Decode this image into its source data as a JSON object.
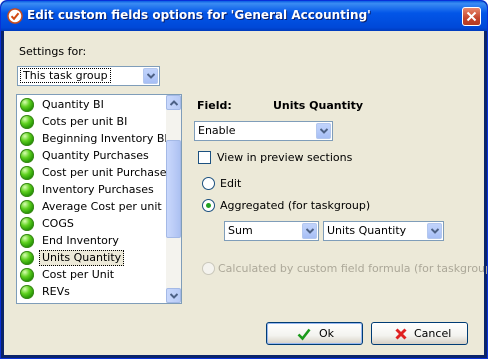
{
  "window": {
    "title": "Edit custom fields options for  'General Accounting'",
    "icons": {
      "app": "check-badge-icon",
      "close": "close-icon"
    }
  },
  "settings": {
    "label": "Settings for:",
    "selected": "This task group"
  },
  "fields_list": {
    "items": [
      {
        "label": "Quantity BI"
      },
      {
        "label": "Cots per unit BI"
      },
      {
        "label": "Beginning Inventory BI"
      },
      {
        "label": "Quantity Purchases"
      },
      {
        "label": "Cost per unit Purchases"
      },
      {
        "label": "Inventory Purchases"
      },
      {
        "label": "Average Cost per unit"
      },
      {
        "label": "COGS"
      },
      {
        "label": "End Inventory"
      },
      {
        "label": "Units Quantity"
      },
      {
        "label": "Cost per Unit"
      },
      {
        "label": "REVs"
      }
    ],
    "selected_index": 9,
    "status_icon": "green-ball-icon"
  },
  "field": {
    "label": "Field:",
    "name": "Units Quantity",
    "mode_select": "Enable",
    "preview_checkbox_label": "View in preview sections",
    "preview_checked": false,
    "edit_radio_label": "Edit",
    "aggregated_radio_label": "Aggregated (for taskgroup)",
    "aggregation_function": "Sum",
    "aggregation_field": "Units Quantity",
    "formula_radio_label": "Calculated by custom field formula (for taskgroup)",
    "selected_mode": "aggregated"
  },
  "buttons": {
    "ok": "Ok",
    "cancel": "Cancel"
  },
  "colors": {
    "title_bar": "#0054e3",
    "dialog_bg": "#ece9d8",
    "ok_icon": "#1a9a1a",
    "cancel_icon": "#e02020"
  }
}
